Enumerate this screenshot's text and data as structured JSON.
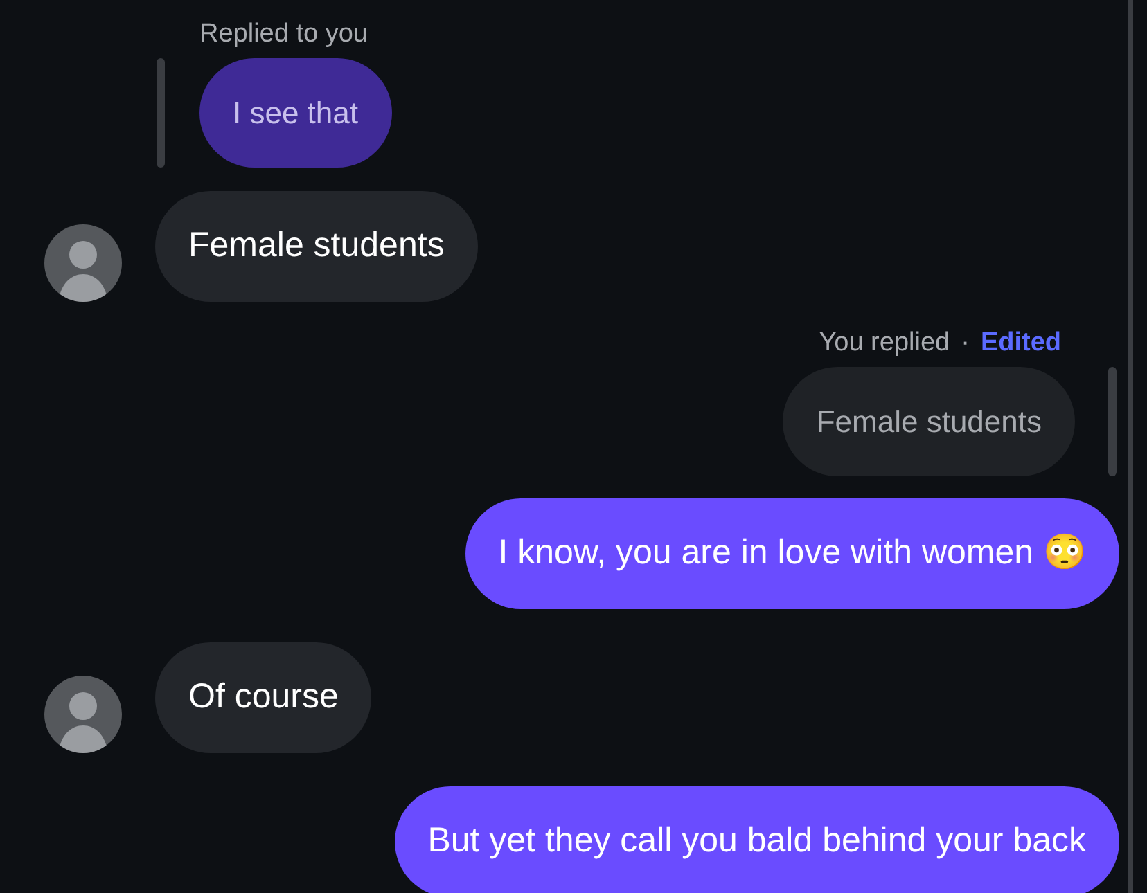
{
  "messages": [
    {
      "kind": "incoming_reply",
      "reply_label": "Replied to you",
      "quoted": "I see that",
      "text": "Female students"
    },
    {
      "kind": "outgoing_reply",
      "reply_label": "You replied",
      "separator": "·",
      "edited_label": "Edited",
      "quoted": "Female students",
      "text": "I know, you are in love with women 😳"
    },
    {
      "kind": "incoming",
      "text": "Of course"
    },
    {
      "kind": "outgoing",
      "text": "But yet they call you bald behind your back"
    }
  ]
}
